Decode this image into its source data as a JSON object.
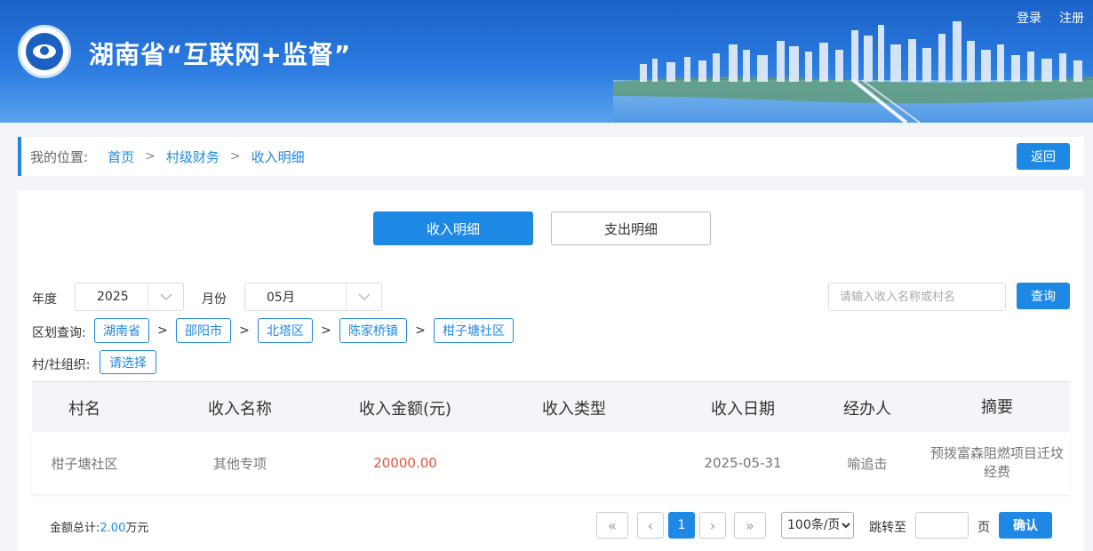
{
  "header": {
    "site_title": "湖南省“互联网+监督”",
    "login": "登录",
    "register": "注册"
  },
  "breadcrumb": {
    "label": "我的位置:",
    "items": [
      "首页",
      "村级财务",
      "收入明细"
    ],
    "separator": ">",
    "back": "返回"
  },
  "tabs": {
    "income": "收入明细",
    "expense": "支出明细"
  },
  "filters": {
    "year_label": "年度",
    "year_value": "2025",
    "month_label": "月份",
    "month_value": "05月",
    "search_placeholder": "请输入收入名称或村名",
    "query": "查询",
    "region_label": "区划查询:",
    "regions": [
      "湖南省",
      "邵阳市",
      "北塔区",
      "陈家桥镇",
      "柑子塘社区"
    ],
    "org_label": "村/社组织:",
    "org_value": "请选择"
  },
  "table": {
    "headers": [
      "村名",
      "收入名称",
      "收入金额(元)",
      "收入类型",
      "收入日期",
      "经办人",
      "摘要"
    ],
    "rows": [
      {
        "village": "柑子塘社区",
        "name": "其他专项",
        "amount": "20000.00",
        "type": "",
        "date": "2025-05-31",
        "handler": "喻追击",
        "summary": "预拨富森阻燃项目迁坟经费"
      }
    ]
  },
  "footer": {
    "total_label": "金额总计:",
    "total_value": "2.00",
    "total_unit": "万元",
    "first": "«",
    "prev": "‹",
    "current_page": "1",
    "next": "›",
    "last": "»",
    "per_page": "100条/页",
    "jump_label": "跳转至",
    "page_unit": "页",
    "confirm": "确认"
  },
  "colors": {
    "primary": "#1e88e5",
    "amount": "#e0553a",
    "header_bg": "#1b62c8"
  }
}
